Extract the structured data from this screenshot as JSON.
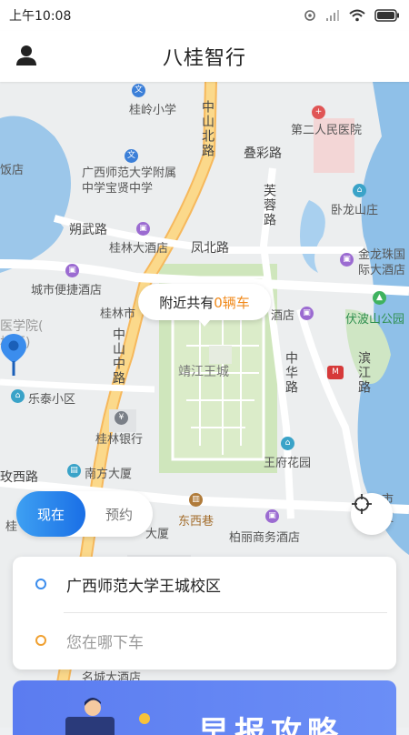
{
  "status_bar": {
    "time": "上午10:08"
  },
  "app_bar": {
    "title": "八桂智行"
  },
  "map": {
    "roads": {
      "zhongshan_north": "中山北路",
      "zhongshan_middle": "中山中路",
      "diecai": "叠彩路",
      "furong": "芙蓉路",
      "shuowu": "朔武路",
      "fengbei": "凤北路",
      "zhonghua": "中华路",
      "binjiang": "滨江路",
      "meixi": "玫西路"
    },
    "labels": {
      "guiling_school": "桂岭小学",
      "hospital": "第二人民医院",
      "fandian": "饭店",
      "gxnu_school": "广西师范大学附属中学宝贤中学",
      "wolongshan": "卧龙山庄",
      "guilin_hotel": "桂林大酒店",
      "jinlongzhu": "金龙珠国际大酒店",
      "city_hotel": "城市便捷酒店",
      "guilin_city": "桂林市",
      "hotel_right": "酒店",
      "fuboshan": "伏波山公园",
      "medical_school": "医学院(",
      "campus": "校区)",
      "jingjiang": "靖江王城",
      "letai": "乐泰小区",
      "guilin_bank": "桂林银行",
      "wangfu": "王府花园",
      "nanfang": "南方大厦",
      "dongxi": "东西巷",
      "berry_hotel": "柏丽商务酒店",
      "dasha": "大厦",
      "gui": "桂",
      "mingcheng": "名城大酒店",
      "shi": "市",
      "jian": "监"
    },
    "bubble": {
      "prefix": "附近共有",
      "count": "0辆车"
    }
  },
  "toggle": {
    "now_label": "现在",
    "book_label": "预约"
  },
  "address": {
    "pickup": "广西师范大学王城校区",
    "dropoff_placeholder": "您在哪下车"
  },
  "banner": {
    "text": "早报攻略"
  },
  "colors": {
    "accent": "#1a6fe6",
    "highlight": "#f08a1c",
    "pickup_dot": "#3b8ded",
    "dropoff_dot": "#f0a030"
  }
}
